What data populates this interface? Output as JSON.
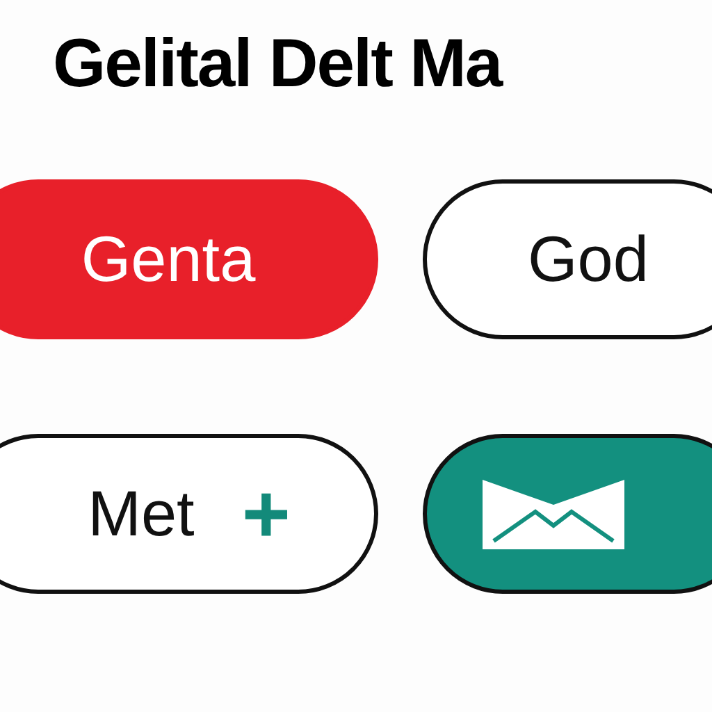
{
  "title": "Gelital Delt Ma",
  "buttons": [
    {
      "kind": "filled",
      "label": "Genta",
      "color": "#e8202a"
    },
    {
      "kind": "outline",
      "label": "God"
    },
    {
      "kind": "outline",
      "label": "Met",
      "symbol": "+",
      "color": "#138a7a"
    },
    {
      "kind": "filled-mail",
      "color": "#13907f"
    }
  ]
}
